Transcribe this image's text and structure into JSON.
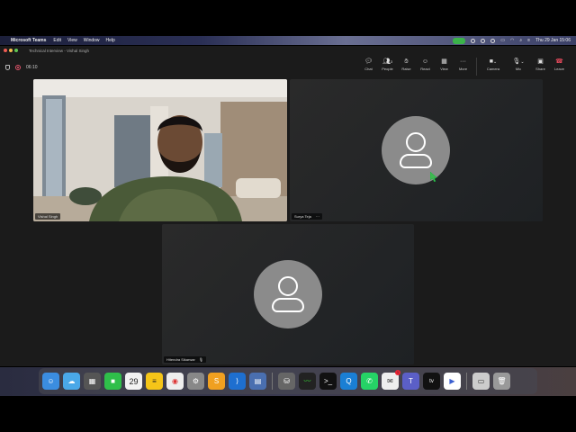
{
  "menubar": {
    "app": "Microsoft Teams",
    "items": [
      "Edit",
      "View",
      "Window",
      "Help"
    ],
    "datetime": "Thu 29 Jan  15:06"
  },
  "window": {
    "title": "Technical Interview - Vishal Singh",
    "timer": "06:10"
  },
  "toolbar": {
    "chat": "Chat",
    "people": "People",
    "people_count": "3",
    "raise": "Raise",
    "react": "React",
    "view": "View",
    "more": "More",
    "camera": "Camera",
    "mic": "Mic",
    "share": "Share",
    "leave": "Leave"
  },
  "participants": {
    "p1": "Vishal Singh",
    "p2": "Surya Teja",
    "p2_more": "···",
    "p3": "Hitendra Sikarwar"
  },
  "dock": {
    "calendar_day": "29",
    "whatsapp_badge": "1",
    "tv_label": "tv"
  }
}
